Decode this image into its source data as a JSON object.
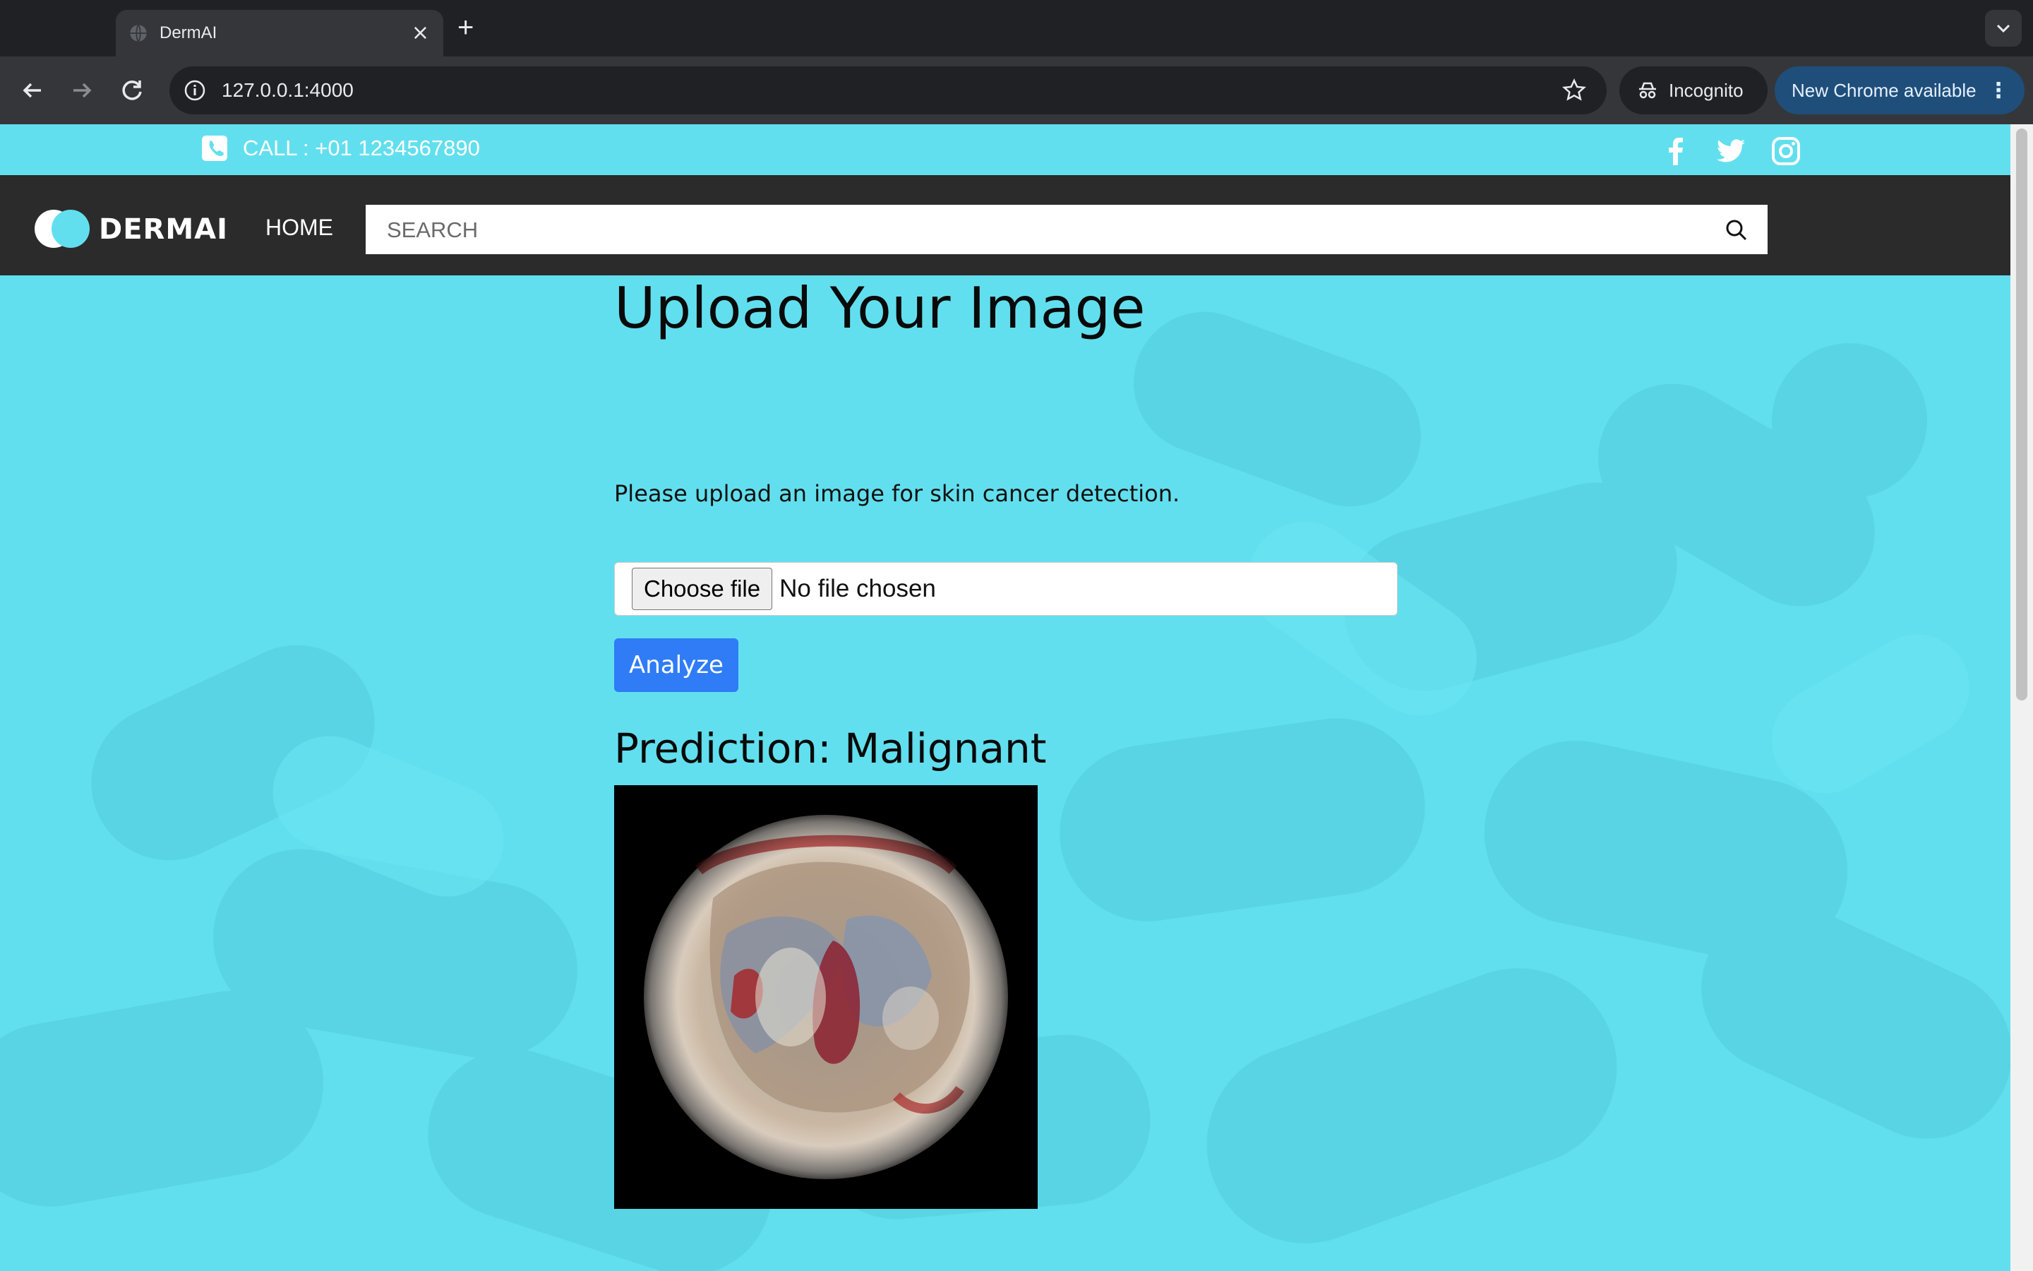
{
  "browser": {
    "tab_title": "DermAI",
    "url": "127.0.0.1:4000",
    "incognito_label": "Incognito",
    "update_label": "New Chrome available"
  },
  "topbar": {
    "call_text": "CALL : +01 1234567890",
    "social_icons": [
      "facebook-icon",
      "twitter-icon",
      "instagram-icon"
    ]
  },
  "navbar": {
    "brand": "DERMAI",
    "home_label": "HOME",
    "search_placeholder": "SEARCH"
  },
  "main": {
    "heading": "Upload Your Image",
    "subtext": "Please upload an image for skin cancer detection.",
    "choose_file_label": "Choose file",
    "no_file_text": "No file chosen",
    "analyze_label": "Analyze",
    "prediction_text": "Prediction: Malignant"
  },
  "colors": {
    "page_background": "#62dfee",
    "navbar_background": "#2b2b2b",
    "analyze_button": "#2f7cf6"
  }
}
